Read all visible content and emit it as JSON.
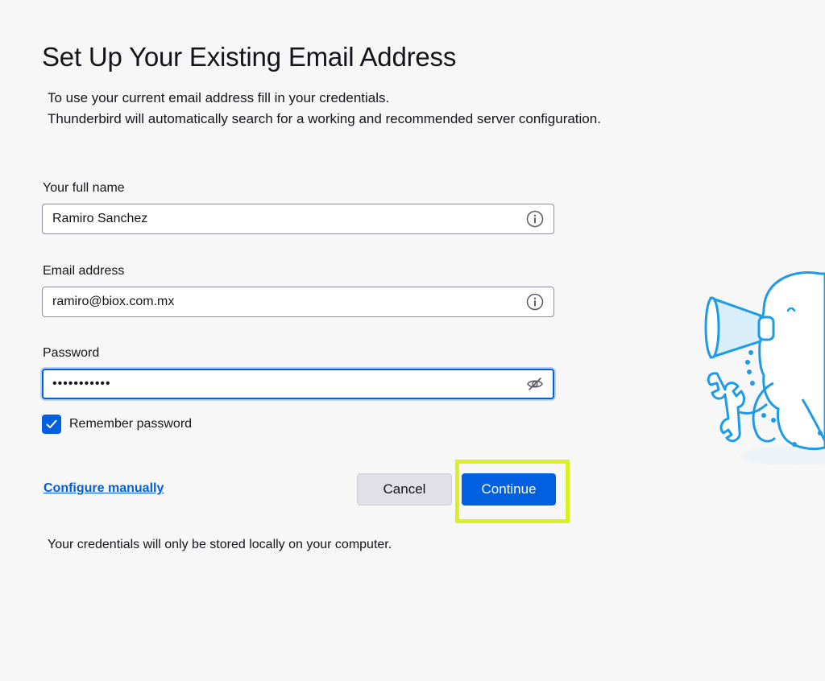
{
  "header": {
    "title": "Set Up Your Existing Email Address",
    "intro_line1": "To use your current email address fill in your credentials.",
    "intro_line2": "Thunderbird will automatically search for a working and recommended server configuration."
  },
  "form": {
    "full_name": {
      "label": "Your full name",
      "value": "Ramiro Sanchez",
      "icon": "info-icon"
    },
    "email": {
      "label": "Email address",
      "value": "ramiro@biox.com.mx",
      "icon": "info-icon"
    },
    "password": {
      "label": "Password",
      "value": "•••••••••••",
      "icon": "eye-slash-icon",
      "focused": true
    },
    "remember": {
      "label": "Remember password",
      "checked": true
    }
  },
  "actions": {
    "configure_manually": "Configure manually",
    "cancel": "Cancel",
    "continue": "Continue"
  },
  "footer": {
    "note": "Your credentials will only be stored locally on your computer."
  },
  "colors": {
    "accent": "#0060df",
    "highlight": "#d9f21f",
    "mascot": "#1e9be6"
  }
}
